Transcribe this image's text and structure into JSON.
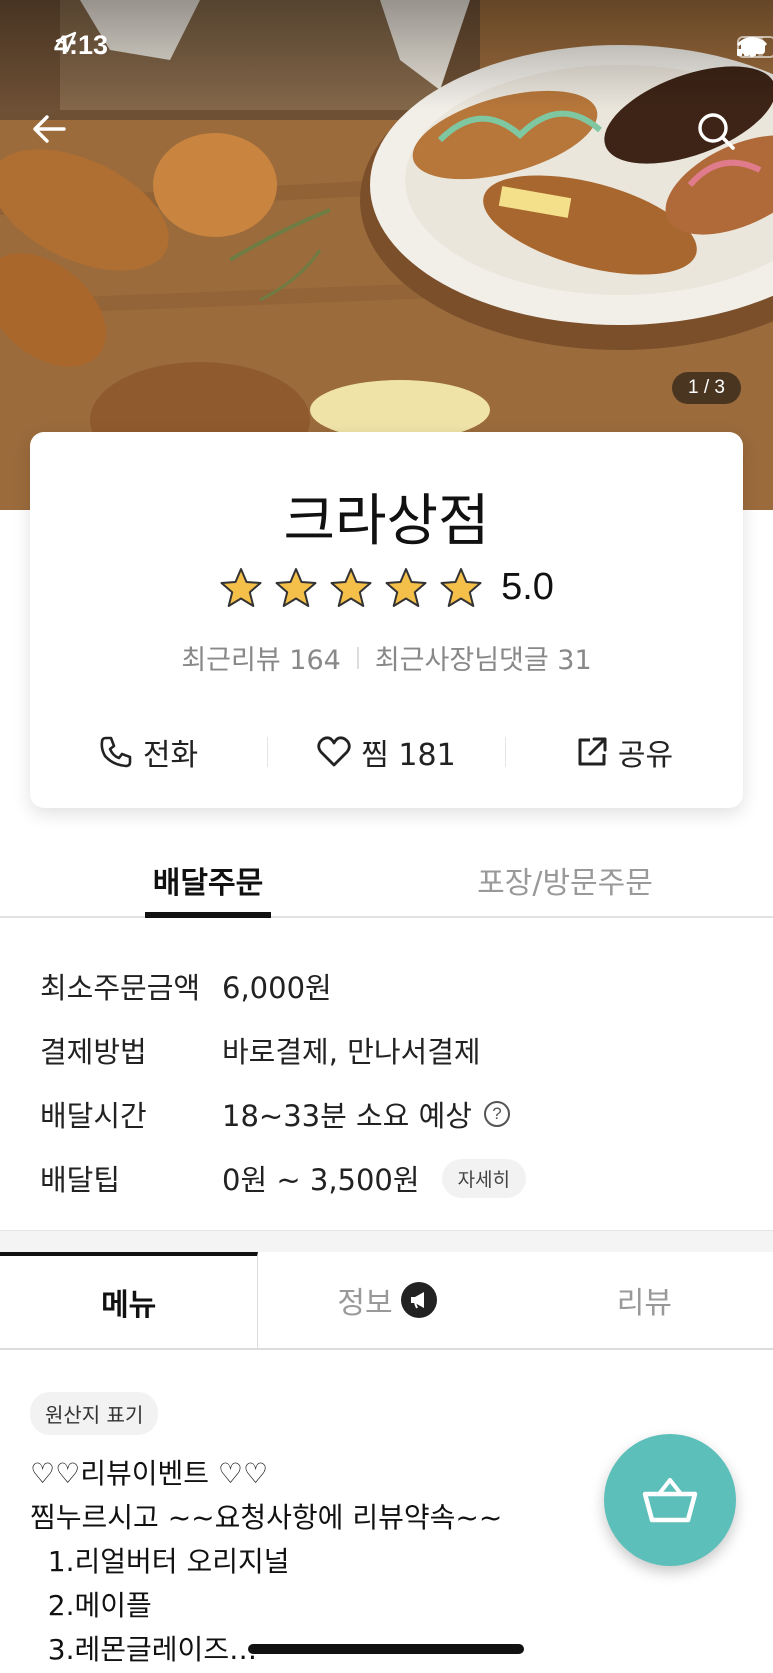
{
  "status_bar": {
    "time": "4:13"
  },
  "hero": {
    "image_counter": "1 / 3"
  },
  "store": {
    "name": "크라상점",
    "rating": "5.0",
    "rating_stars": 5,
    "recent_reviews": "최근리뷰 164",
    "owner_replies": "최근사장님댓글 31"
  },
  "actions": {
    "call": "전화",
    "favorite": "찜 181",
    "share": "공유"
  },
  "order_tabs": {
    "delivery": "배달주문",
    "pickup": "포장/방문주문"
  },
  "info": {
    "min_order_label": "최소주문금액",
    "min_order_value": "6,000원",
    "payment_label": "결제방법",
    "payment_value": "바로결제, 만나서결제",
    "delivery_time_label": "배달시간",
    "delivery_time_value": "18~33분 소요 예상",
    "delivery_tip_label": "배달팁",
    "delivery_tip_value": "0원 ~ 3,500원",
    "detail_button": "자세히"
  },
  "menu_tabs": {
    "menu": "메뉴",
    "info": "정보",
    "review": "리뷰"
  },
  "origin_chip": "원산지 표기",
  "notice_lines": [
    "♡♡리뷰이벤트 ♡♡",
    "찜누르시고 ~~요청사항에 리뷰약속~~",
    "  1.리얼버터 오리지널",
    "  2.메이플",
    "  3.레몬글레이즈…"
  ],
  "colors": {
    "accent": "#5dbfba",
    "star": "#f5c04a"
  }
}
